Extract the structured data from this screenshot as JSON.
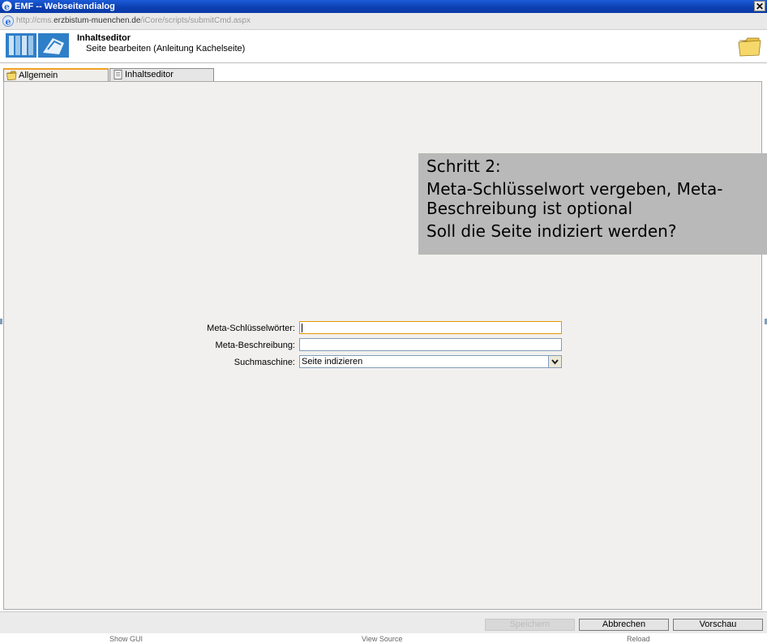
{
  "window": {
    "title": "EMF -- Webseitendialog",
    "close_glyph": "✕"
  },
  "address": {
    "url_prefix": "http://cms.",
    "url_domain": "erzbistum-muenchen.de",
    "url_path": "/iCore/scripts/submitCmd.aspx"
  },
  "header": {
    "title": "Inhaltseditor",
    "subtitle": "Seite bearbeiten (Anleitung Kachelseite)"
  },
  "tabs": [
    {
      "label": "Allgemein",
      "active": true
    },
    {
      "label": "Inhaltseditor",
      "active": false
    }
  ],
  "callout": {
    "line1": "Schritt 2:",
    "line2": "Meta-Schlüsselwort vergeben, Meta-Beschreibung ist optional",
    "line3": "Soll die Seite indiziert werden?"
  },
  "form": {
    "keywords_label": "Meta-Schlüsselwörter:",
    "keywords_value": "",
    "description_label": "Meta-Beschreibung:",
    "description_value": "",
    "searchengine_label": "Suchmaschine:",
    "searchengine_value": "Seite indizieren"
  },
  "buttons": {
    "save": "Speichern",
    "cancel": "Abbrechen",
    "preview": "Vorschau"
  },
  "footer": {
    "show_gui": "Show GUI",
    "view_source": "View Source",
    "reload": "Reload"
  },
  "colors": {
    "titlebar": "#0b3eb0",
    "panel_bg": "#f2f0ee",
    "callout_bg": "#b9b9b9",
    "active_tab_accent": "#f0a023"
  }
}
